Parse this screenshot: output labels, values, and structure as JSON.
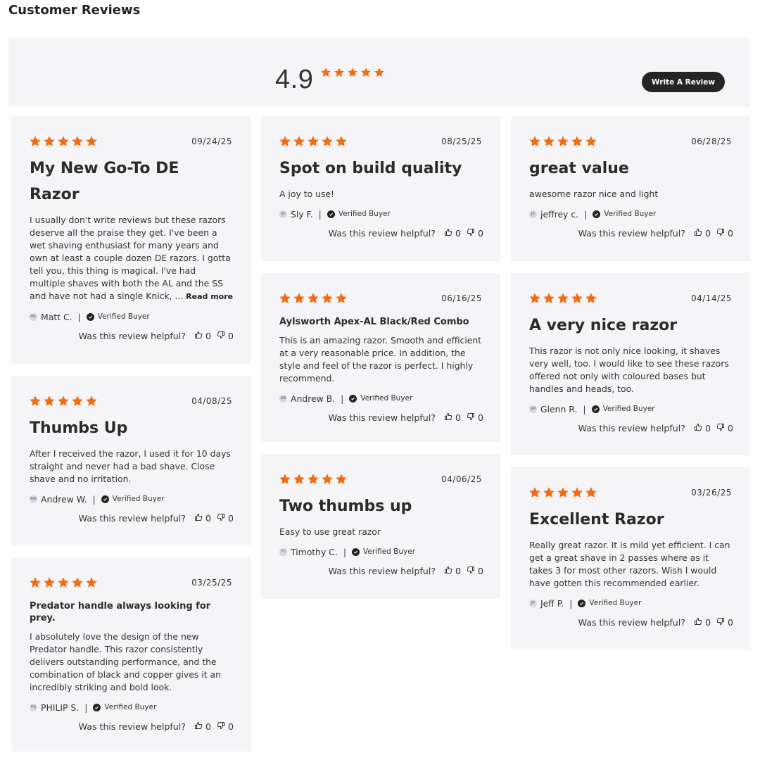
{
  "page": {
    "title": "Customer Reviews"
  },
  "summary": {
    "average": "4.9",
    "star_count": 5,
    "write_review_label": "Write A Review"
  },
  "colors": {
    "star": "#f26c14",
    "card_bg": "#f5f4f6",
    "button_bg": "#252525"
  },
  "labels": {
    "verified": "Verified Buyer",
    "helpful": "Was this review helpful?",
    "read_more": "Read more"
  },
  "reviews": [
    {
      "rating": 5,
      "date": "09/24/25",
      "title": "My New Go-To DE Razor",
      "body": "I usually don't write reviews but these razors deserve all the praise they get. I've been a wet shaving enthusiast for many years and own at least a couple dozen DE razors. I gotta tell you, this thing is magical. I've had multiple shaves with both the AL and the SS and have not had a single Knick, ...",
      "read_more": true,
      "initials": "MC",
      "author": "Matt C.",
      "up": "0",
      "down": "0"
    },
    {
      "rating": 5,
      "date": "04/08/25",
      "title": "Thumbs Up",
      "body": "After I received the razor, I used it for 10 days straight and never had a bad shave. Close shave and no irritation.",
      "initials": "AW",
      "author": "Andrew W.",
      "up": "0",
      "down": "0"
    },
    {
      "rating": 5,
      "date": "03/25/25",
      "title": "Predator handle always looking for prey.",
      "small_title": true,
      "body": "I absolutely love the design of the new Predator handle. This razor consistently delivers outstanding performance, and the combination of black and copper gives it an incredibly striking and bold look.",
      "initials": "PS",
      "author": "PHILIP S.",
      "up": "0",
      "down": "0"
    },
    {
      "rating": 5,
      "date": "08/25/25",
      "title": "Spot on build quality",
      "body": "A joy to use!",
      "initials": "SF",
      "author": "Sly F.",
      "up": "0",
      "down": "0"
    },
    {
      "rating": 5,
      "date": "06/16/25",
      "title": "Aylsworth Apex-AL Black/Red Combo",
      "small_title": true,
      "body": "This is an amazing razor. Smooth and efficient at a very reasonable price. In addition, the style and feel of the razor is perfect. I highly recommend.",
      "initials": "AB",
      "author": "Andrew B.",
      "up": "0",
      "down": "0"
    },
    {
      "rating": 5,
      "date": "04/06/25",
      "title": "Two thumbs up",
      "body": "Easy to use great razor",
      "initials": "TC",
      "author": "Timothy C.",
      "up": "0",
      "down": "0"
    },
    {
      "rating": 5,
      "date": "06/28/25",
      "title": "great value",
      "body": "awesome razor nice and light",
      "initials": "JC",
      "author": "jeffrey c.",
      "up": "0",
      "down": "0"
    },
    {
      "rating": 5,
      "date": "04/14/25",
      "title": "A very nice razor",
      "body": "This razor is not only nice looking, it shaves very well, too. I would like to see these razors offered not only with coloured bases but handles and heads, too.",
      "initials": "GR",
      "author": "Glenn R.",
      "up": "0",
      "down": "0"
    },
    {
      "rating": 5,
      "date": "03/26/25",
      "title": "Excellent Razor",
      "body": "Really great razor. It is mild yet efficient. I can get a great shave in 2 passes where as it takes 3 for most other razors. Wish I would have gotten this recommended earlier.",
      "initials": "JP",
      "author": "Jeff P.",
      "up": "0",
      "down": "0"
    }
  ]
}
